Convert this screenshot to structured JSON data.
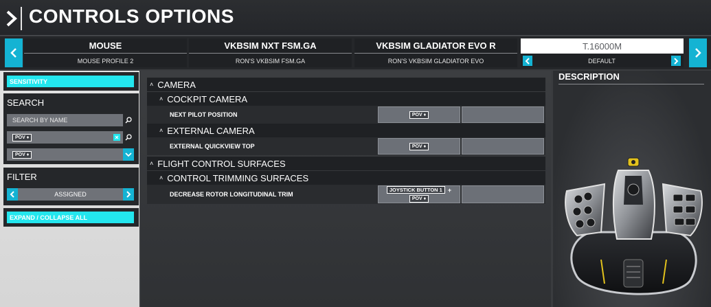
{
  "header": {
    "title": "CONTROLS OPTIONS"
  },
  "devices": [
    {
      "name": "MOUSE",
      "profile": "MOUSE PROFILE 2"
    },
    {
      "name": "VKBSIM NXT FSM.GA",
      "profile": "RON'S VKBSIM FSM.GA"
    },
    {
      "name": "VKBSIM GLADIATOR EVO R",
      "profile": "RON'S VKBSIM GLADIATOR EVO"
    },
    {
      "name": "T.16000M",
      "profile": "DEFAULT"
    }
  ],
  "left": {
    "sensitivity_label": "SENSITIVITY",
    "search_title": "SEARCH",
    "search_placeholder": "SEARCH BY NAME",
    "search_by_input_tag": "POV ♦",
    "input_selector_tag": "POV ♦",
    "filter_title": "FILTER",
    "filter_value": "ASSIGNED",
    "expand_label": "EXPAND / COLLAPSE ALL"
  },
  "bindings": {
    "camera": "CAMERA",
    "cockpit_camera": "COCKPIT CAMERA",
    "next_pilot_position": "NEXT PILOT POSITION",
    "next_pilot_binding": "POV ♦",
    "external_camera": "EXTERNAL CAMERA",
    "external_quickview_top": "EXTERNAL QUICKVIEW TOP",
    "external_quickview_binding": "POV ♦",
    "flight_control_surfaces": "FLIGHT CONTROL SURFACES",
    "control_trimming_surfaces": "CONTROL TRIMMING SURFACES",
    "decrease_rotor_trim": "DECREASE ROTOR LONGITUDINAL TRIM",
    "decrease_rotor_binding_1": "JOYSTICK BUTTON 1",
    "decrease_rotor_plus": "+",
    "decrease_rotor_binding_2": "POV ♦"
  },
  "description": {
    "title": "DESCRIPTION"
  },
  "colors": {
    "accent": "#14b3d3",
    "cyan_button": "#23e6ee"
  }
}
